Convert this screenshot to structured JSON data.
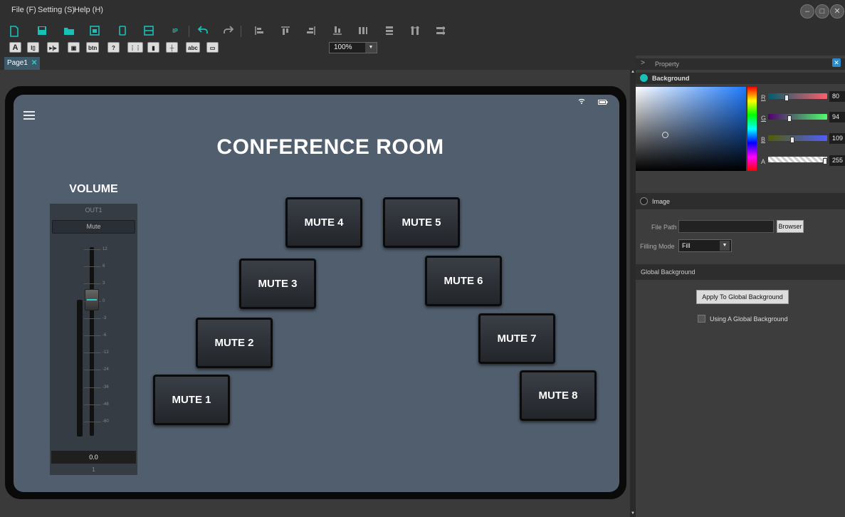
{
  "menu": {
    "file": "File (F)",
    "setting": "Setting (S)",
    "help": "Help (H)"
  },
  "window_controls": {
    "minimize": "–",
    "maximize": "□",
    "close": "✕"
  },
  "toolbar": {
    "zoom_value": "100%",
    "ip_label": "IP"
  },
  "widget_toolbar": {
    "text_label": "A",
    "button_label": "btn",
    "help_label": "?",
    "textbox_label": "abc"
  },
  "tab": {
    "label": "Page1"
  },
  "screen": {
    "title": "CONFERENCE ROOM",
    "volume": {
      "title": "VOLUME",
      "channel": "OUT1",
      "mute_label": "Mute",
      "scale": [
        "12",
        "6",
        "3",
        "0",
        "-3",
        "-6",
        "-12",
        "-24",
        "-36",
        "-48",
        "-60"
      ],
      "value": "0.0",
      "channel_number": "1"
    },
    "mute_buttons": [
      "MUTE 1",
      "MUTE 2",
      "MUTE 3",
      "MUTE 4",
      "MUTE 5",
      "MUTE 6",
      "MUTE 7",
      "MUTE 8"
    ]
  },
  "property": {
    "header": "Property",
    "background": {
      "label": "Background",
      "r_label": "R",
      "g_label": "G",
      "b_label": "B",
      "a_label": "A",
      "r": 80,
      "g": 94,
      "b": 109,
      "a": 255
    },
    "image": {
      "label": "Image",
      "file_path_label": "File Path",
      "file_path_value": "",
      "browser_label": "Browser",
      "filling_mode_label": "Filling Mode",
      "filling_mode_value": "Fill"
    },
    "global_background": {
      "label": "Global Background",
      "apply_label": "Apply To Global Background",
      "use_global_label": "Using A Global Background"
    }
  },
  "colors": {
    "accent": "#19c0b8",
    "screen_bg": "#505e6d",
    "panel_bg": "#3d3d3d"
  }
}
